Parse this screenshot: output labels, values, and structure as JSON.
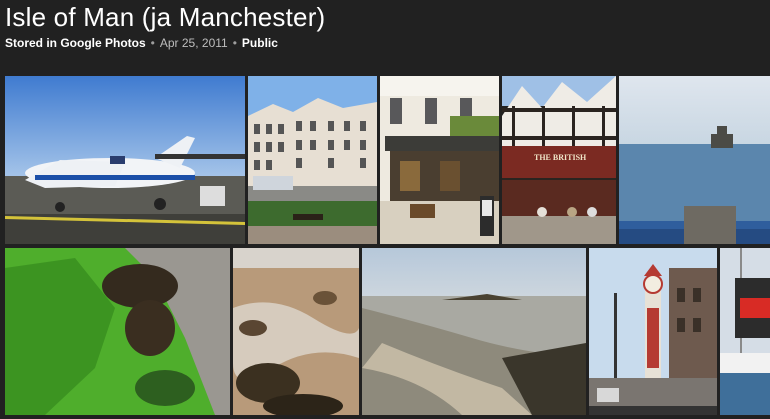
{
  "album": {
    "title": "Isle of Man (ja Manchester)",
    "storage": "Stored in Google Photos",
    "separator": "•",
    "date": "Apr 25, 2011",
    "visibility": "Public"
  },
  "photos": [
    {
      "id": "airplane",
      "icon": "photo-thumbnail"
    },
    {
      "id": "street-buildings",
      "icon": "photo-thumbnail"
    },
    {
      "id": "pub-facade",
      "icon": "photo-thumbnail"
    },
    {
      "id": "british-pub",
      "sign_text": "THE BRITISH",
      "icon": "photo-thumbnail"
    },
    {
      "id": "sea-tower",
      "icon": "photo-thumbnail"
    },
    {
      "id": "green-seaweed",
      "icon": "photo-thumbnail"
    },
    {
      "id": "rock-pools",
      "icon": "photo-thumbnail"
    },
    {
      "id": "low-tide-beach",
      "icon": "photo-thumbnail"
    },
    {
      "id": "clock-tower",
      "icon": "photo-thumbnail"
    },
    {
      "id": "harbour-boat",
      "icon": "photo-thumbnail"
    }
  ]
}
